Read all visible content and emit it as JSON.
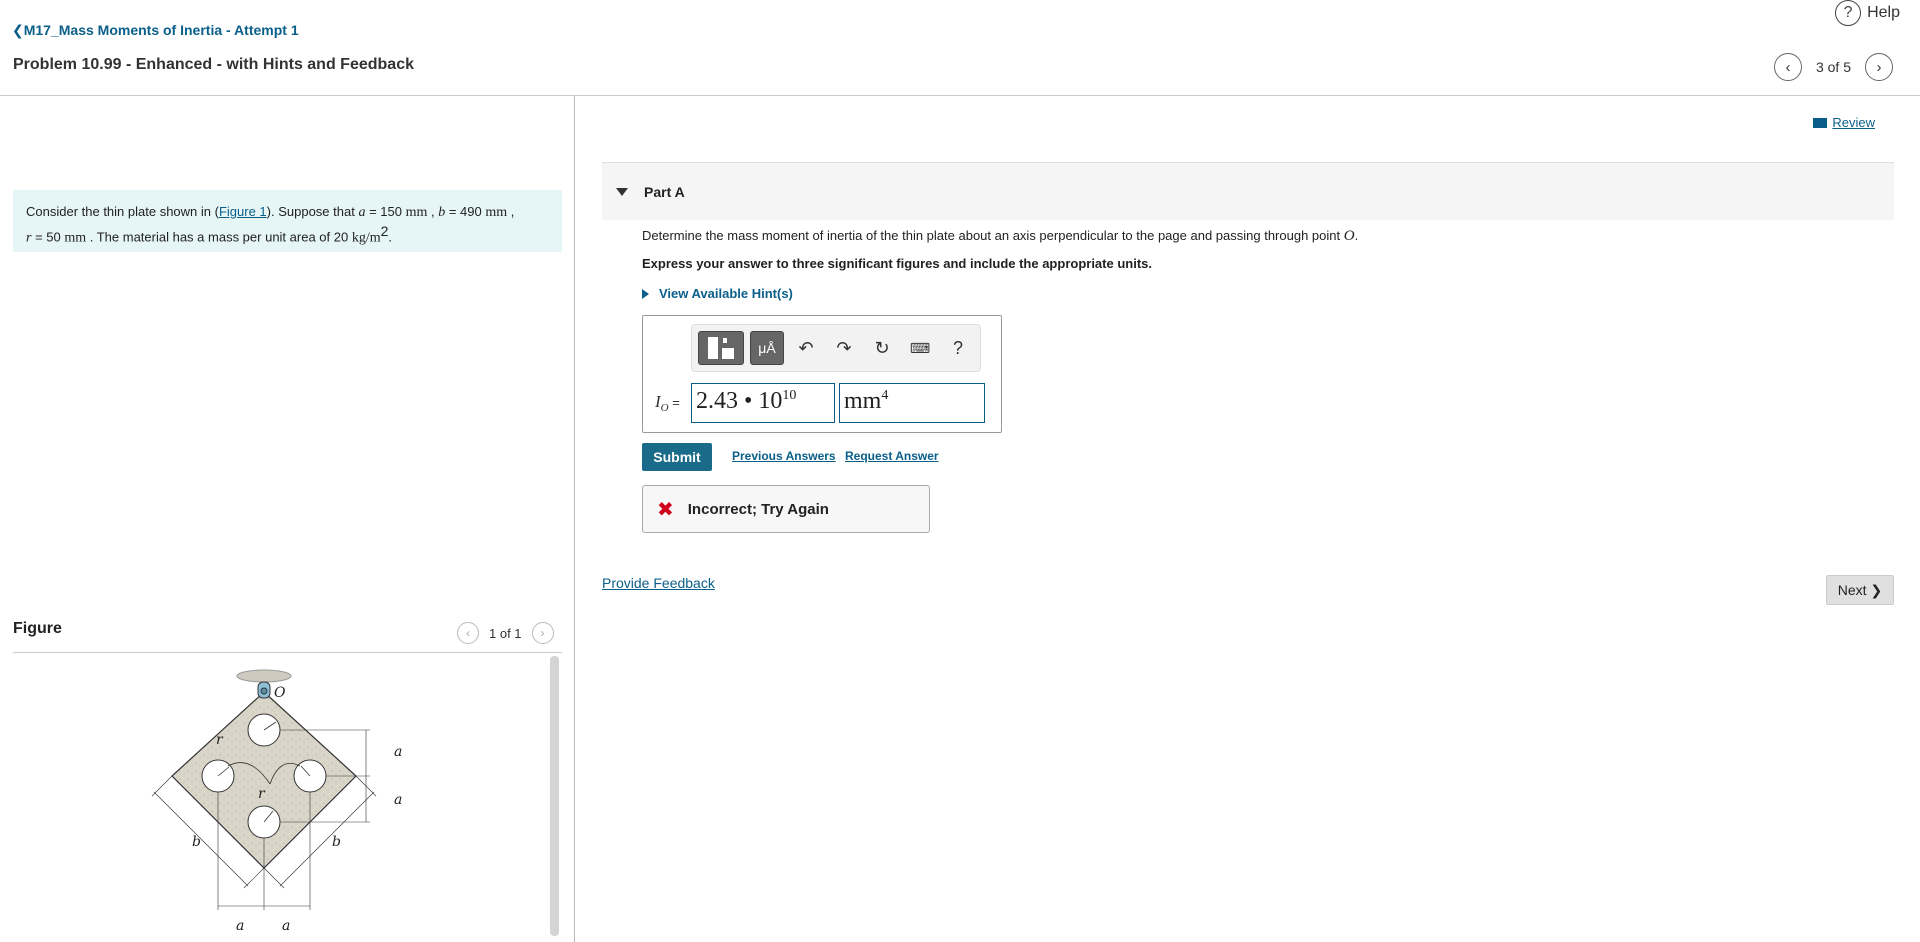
{
  "header": {
    "help_label": "Help",
    "back_link": "M17_Mass Moments of Inertia - Attempt 1",
    "problem_title": "Problem 10.99 - Enhanced - with Hints and Feedback",
    "pager": "3 of 5"
  },
  "intro": {
    "text_1": "Consider the thin plate shown in (",
    "figure_link": "Figure 1",
    "text_2": "). Suppose that",
    "a_sym": "a",
    "a_val": " = 150 ",
    "a_unit": "mm",
    "b_sym": "b",
    "b_val": " = 490 ",
    "b_unit": "mm",
    "r_sym": "r",
    "r_val": " = 50 ",
    "r_unit": "mm",
    "text_3": ". The material has a mass per unit area of 20",
    "density_unit": "kg/m",
    "density_exp": "2"
  },
  "figure": {
    "heading": "Figure",
    "pager": "1 of 1",
    "labels": {
      "O": "O",
      "r": "r",
      "a": "a",
      "b": "b"
    }
  },
  "review": {
    "label": "Review"
  },
  "part": {
    "label": "Part A",
    "question": "Determine the mass moment of inertia of the thin plate about an axis perpendicular to the page and passing through point",
    "point": "O",
    "instruction": "Express your answer to three significant figures and include the appropriate units.",
    "hints_label": "View Available Hint(s)",
    "answer_label": "I",
    "answer_sub": "O",
    "answer_eq": " =",
    "value_mantissa": "2.43 • 10",
    "value_exponent": "10",
    "unit": "mm",
    "unit_exponent": "4",
    "toolbar": {
      "units_btn": "μÅ",
      "help_btn": "?"
    },
    "submit_label": "Submit",
    "previous_answers": "Previous Answers",
    "request_answer": "Request Answer",
    "feedback": "Incorrect; Try Again"
  },
  "footer": {
    "provide_feedback": "Provide Feedback",
    "next_label": "Next"
  }
}
